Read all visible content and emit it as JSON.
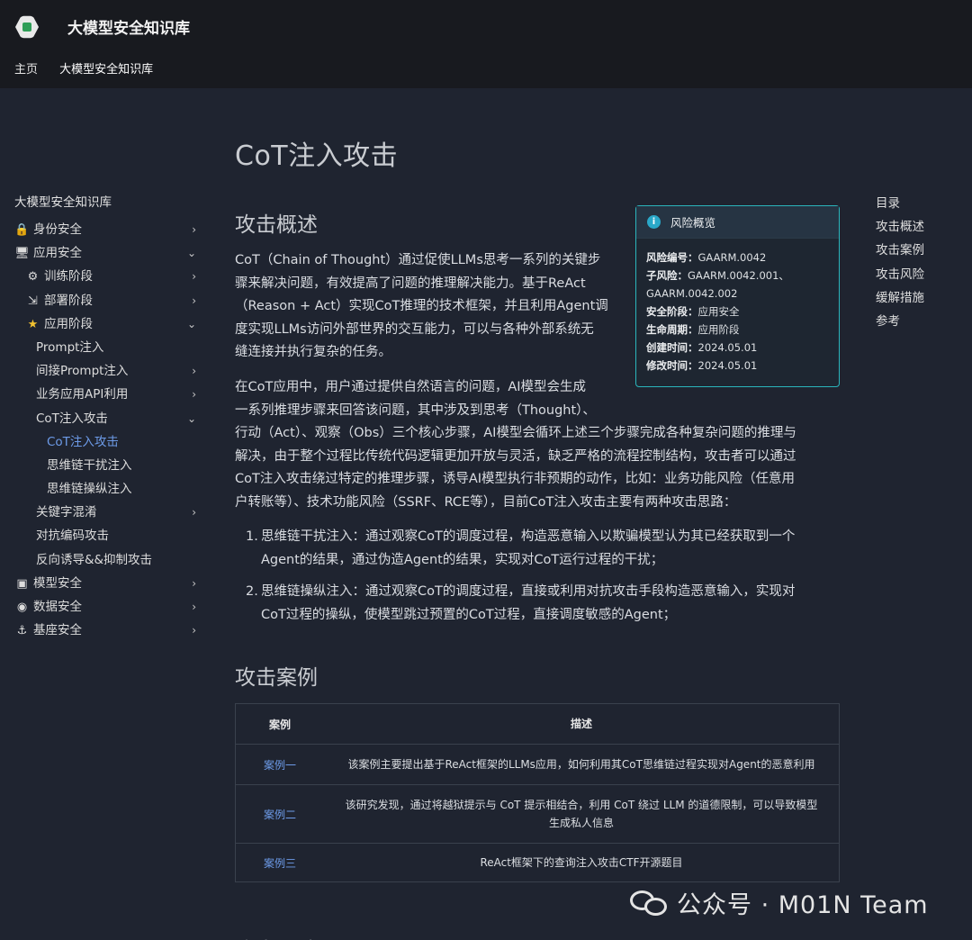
{
  "header": {
    "site_title": "大模型安全知识库",
    "nav": [
      "主页",
      "大模型安全知识库"
    ]
  },
  "sidebar": {
    "root": "大模型安全知识库",
    "items": [
      {
        "label": "身份安全",
        "icon": "lock-icon",
        "level": 0,
        "chevron": "›"
      },
      {
        "label": "应用安全",
        "icon": "monitor-icon",
        "level": 0,
        "chevron": "⌄"
      },
      {
        "label": "训练阶段",
        "icon": "gear-icon",
        "level": 1,
        "chevron": "›"
      },
      {
        "label": "部署阶段",
        "icon": "deploy-icon",
        "level": 1,
        "chevron": "›"
      },
      {
        "label": "应用阶段",
        "icon": "star-icon",
        "level": 1,
        "chevron": "⌄"
      },
      {
        "label": "Prompt注入",
        "level": 2,
        "chevron": ""
      },
      {
        "label": "间接Prompt注入",
        "level": 2,
        "chevron": "›"
      },
      {
        "label": "业务应用API利用",
        "level": 2,
        "chevron": "›"
      },
      {
        "label": "CoT注入攻击",
        "level": 2,
        "chevron": "⌄"
      },
      {
        "label": "CoT注入攻击",
        "level": 3,
        "chevron": "",
        "active": true
      },
      {
        "label": "思维链干扰注入",
        "level": 3,
        "chevron": ""
      },
      {
        "label": "思维链操纵注入",
        "level": 3,
        "chevron": ""
      },
      {
        "label": "关键字混淆",
        "level": 2,
        "chevron": "›"
      },
      {
        "label": "对抗编码攻击",
        "level": 2,
        "chevron": ""
      },
      {
        "label": "反向诱导&&抑制攻击",
        "level": 2,
        "chevron": ""
      },
      {
        "label": "模型安全",
        "icon": "model-icon",
        "level": 0,
        "chevron": "›"
      },
      {
        "label": "数据安全",
        "icon": "data-icon",
        "level": 0,
        "chevron": "›"
      },
      {
        "label": "基座安全",
        "icon": "anchor-icon",
        "level": 0,
        "chevron": "›"
      }
    ]
  },
  "main": {
    "title": "CoT注入攻击",
    "overview_heading": "攻击概述",
    "para1": [
      "CoT（Chain of Thought）通过促使LLMs思考一系列的关键步",
      "骤来解决问题，有效提高了问题的推理解决能力。基于ReAct",
      "（Reason + Act）实现CoT推理的技术框架，并且利用Agent调",
      "度实现LLMs访问外部世界的交互能力，可以与各种外部系统无",
      "缝连接并执行复杂的任务。"
    ],
    "para2": [
      "在CoT应用中，用户通过提供自然语言的问题，AI模型会生成",
      "一系列推理步骤来回答该问题，其中涉及到思考（Thought）、",
      "行动（Act）、观察（Obs）三个核心步骤，AI模型会循环上述三个步骤完成各种复杂问题的推理与",
      "解决，由于整个过程比传统代码逻辑更加开放与灵活，缺乏严格的流程控制结构，攻击者可以通过",
      "CoT注入攻击绕过特定的推理步骤，诱导AI模型执行非预期的动作，比如：业务功能风险（任意用",
      "户转账等）、技术功能风险（SSRF、RCE等），目前CoT注入攻击主要有两种攻击思路："
    ],
    "list": [
      {
        "num": "1.",
        "lines": [
          "思维链干扰注入：通过观察CoT的调度过程，构造恶意输入以欺骗模型认为其已经获取到一个",
          "Agent的结果，通过伪造Agent的结果，实现对CoT运行过程的干扰；"
        ]
      },
      {
        "num": "2.",
        "lines": [
          "思维链操纵注入：通过观察CoT的调度过程，直接或利用对抗攻击手段构造恶意输入，实现对",
          "CoT过程的操纵，使模型跳过预置的CoT过程，直接调度敏感的Agent；"
        ]
      }
    ],
    "cases_heading": "攻击案例",
    "table": {
      "headers": [
        "案例",
        "描述"
      ],
      "rows": [
        {
          "case": "案例一",
          "desc": "该案例主要提出基于ReAct框架的LLMs应用，如何利用其CoT思维链过程实现对Agent的恶意利用"
        },
        {
          "case": "案例二",
          "desc": "该研究发现，通过将越狱提示与 CoT 提示相结合，利用 CoT 绕过 LLM 的道德限制，可以导致模型生成私人信息"
        },
        {
          "case": "案例三",
          "desc": "ReAct框架下的查询注入攻击CTF开源题目"
        }
      ]
    },
    "next_heading": "攻击风险"
  },
  "risk_panel": {
    "title": "风险概览",
    "fields": [
      {
        "label": "风险编号：",
        "value": "GAARM.0042"
      },
      {
        "label": "子风险：",
        "value": "GAARM.0042.001、"
      },
      {
        "label": "",
        "value": "GAARM.0042.002"
      },
      {
        "label": "安全阶段：",
        "value": "应用安全"
      },
      {
        "label": "生命周期：",
        "value": "应用阶段"
      },
      {
        "label": "创建时间：",
        "value": "2024.05.01"
      },
      {
        "label": "修改时间：",
        "value": "2024.05.01"
      }
    ]
  },
  "toc": {
    "items": [
      "目录",
      "攻击概述",
      "攻击案例",
      "攻击风险",
      "缓解措施",
      "参考"
    ]
  },
  "watermark": {
    "text": "公众号 · M01N Team"
  },
  "colors": {
    "background": "#1f2430",
    "header": "#181a1f",
    "accent_link": "#6d9be8",
    "panel_border": "#2bb5bc"
  }
}
